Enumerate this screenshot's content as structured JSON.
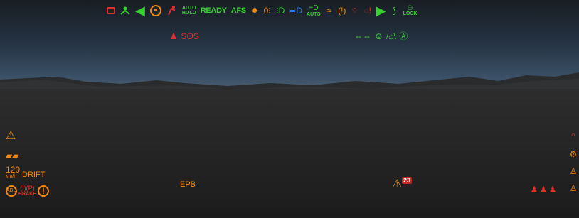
{
  "top_bar": {
    "auto_hold": [
      "AUTO",
      "HOLD"
    ],
    "ready": "READY",
    "afs": "AFS",
    "auto": "AUTO",
    "lock": "LOCK"
  },
  "upper_indicators": {
    "sos": "SOS"
  },
  "left_indicators": {
    "speed": "120",
    "speed_unit": "km/h",
    "drift": "DRIFT",
    "abs": "ABS",
    "brake": "BRAKE"
  },
  "bottom": {
    "epb": "EPB",
    "warning_count": "23"
  },
  "colors": {
    "green": "#36d12f",
    "orange": "#f28a12",
    "red": "#e0312b",
    "blue": "#2f7af0"
  }
}
